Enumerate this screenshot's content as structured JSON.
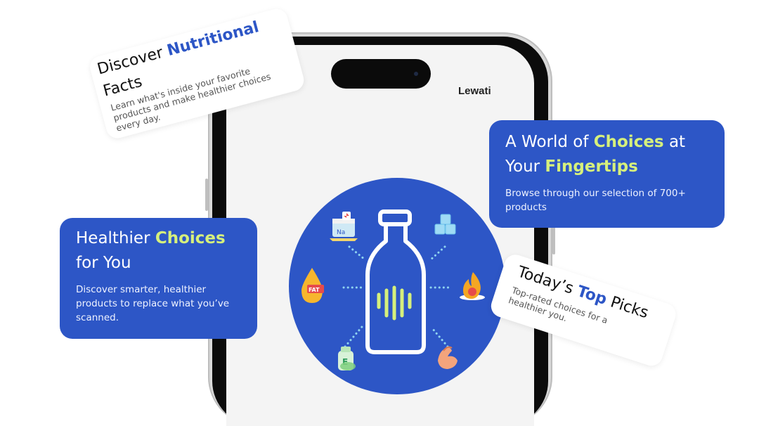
{
  "colors": {
    "accent": "#2d56c6",
    "highlight": "#d6f07c"
  },
  "phone": {
    "brand": "Lewati"
  },
  "card_nutrition": {
    "title_prefix": "Discover",
    "title_highlight": "Nutritional",
    "title_line2": "Facts",
    "subtitle": "Learn what's inside your favorite products and make healthier choices every day."
  },
  "card_choices_world": {
    "title_prefix": "A World of",
    "title_highlight1": "Choices",
    "title_middle": "at",
    "title_line2_prefix": "Your",
    "title_highlight2": "Fingertips",
    "subtitle": "Browse through our selection of 700+ products"
  },
  "card_healthier": {
    "title_prefix": "Healthier",
    "title_highlight": "Choices",
    "title_line2": "for You",
    "subtitle": "Discover smarter, healthier products to replace what you’ve scanned."
  },
  "card_top_picks": {
    "title_prefix": "Today’s",
    "title_highlight": "Top",
    "title_suffix": "Picks",
    "subtitle": "Top-rated choices for a healthier you."
  },
  "icons": {
    "bottle": "bottle-barcode-icon",
    "salt": "salt-sodium-icon",
    "sugar": "sugar-cubes-icon",
    "fat": "fat-drop-icon",
    "calories": "calorie-flame-icon",
    "additives": "e-number-additive-icon",
    "protein": "protein-muscle-icon",
    "fat_label": "FAT",
    "salt_label": "Na",
    "additive_label": "E"
  }
}
